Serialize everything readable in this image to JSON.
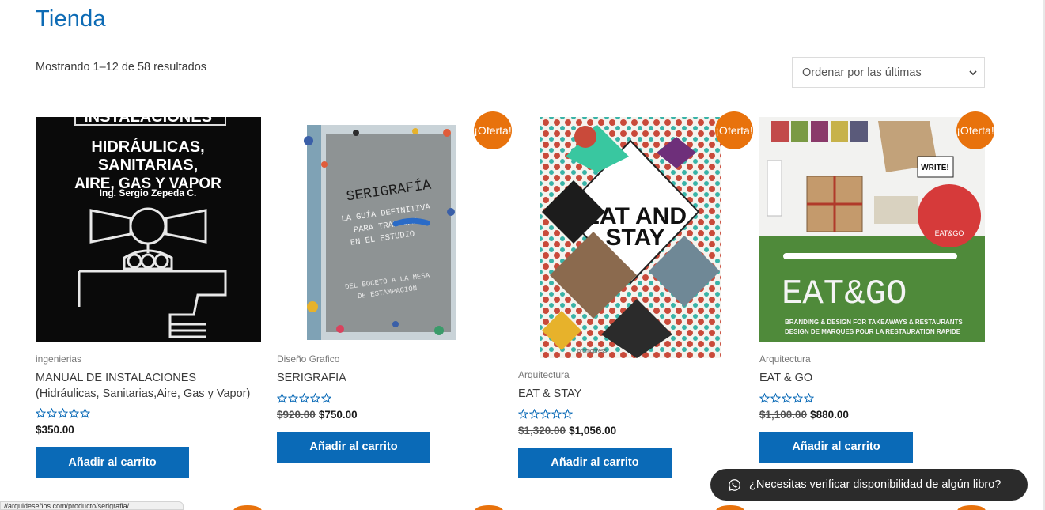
{
  "page": {
    "title": "Tienda"
  },
  "toolbar": {
    "result_count": "Mostrando 1–12 de 58 resultados",
    "orderby_label": "Ordenar por las últimas"
  },
  "products": [
    {
      "category": "ingenierias",
      "title": "MANUAL DE INSTALACIONES (Hidráulicas, Sanitarias,Aire, Gas y Vapor)",
      "price": "$350.00",
      "old_price": "",
      "on_sale": false,
      "button": "Añadir al carrito",
      "cover_text": [
        "INSTALACIONES",
        "HIDRÁULICAS,",
        "SANITARIAS,",
        "AIRE, GAS Y VAPOR",
        "Ing. Sergio Zepeda C."
      ]
    },
    {
      "category": "Diseño Grafico",
      "title": "SERIGRAFIA",
      "price": "$750.00",
      "old_price": "$920.00",
      "on_sale": true,
      "sale_label": "¡Oferta!",
      "button": "Añadir al carrito",
      "cover_text": [
        "SERIGRAFÍA",
        "LA GUÍA DEFINITIVA",
        "PARA TRABAJAR",
        "EN EL ESTUDIO",
        "DEL BOCETO A LA MESA",
        "DE ESTAMPACIÓN"
      ]
    },
    {
      "category": "Arquitectura",
      "title": "EAT & STAY",
      "price": "$1,056.00",
      "old_price": "$1,320.00",
      "on_sale": true,
      "sale_label": "¡Oferta!",
      "button": "Añadir al carrito",
      "cover_text": [
        "EAT AND",
        "STAY",
        "promopress"
      ]
    },
    {
      "category": "Arquitectura",
      "title": "EAT & GO",
      "price": "$880.00",
      "old_price": "$1,100.00",
      "on_sale": true,
      "sale_label": "¡Oferta!",
      "button": "Añadir al carrito",
      "cover_text": [
        "EAT&GO",
        "BRANDING & DESIGN FOR TAKEAWAYS & RESTAURANTS",
        "DESIGN DE MARQUES POUR LA RESTAURATION RAPIDE",
        "WRITE!",
        "EAT&GO"
      ]
    }
  ],
  "whatsapp": {
    "label": "¿Necesitas verificar disponibilidad de algún libro?"
  },
  "status_bar": {
    "url": "//arquideseños.com/producto/serigrafia/"
  },
  "colors": {
    "accent": "#0a6ab7",
    "sale": "#e8720c",
    "title": "#0d6bb5"
  },
  "icons": {
    "sort": "chevron-down-icon",
    "rating": "star-outline-icon",
    "chat": "whatsapp-icon"
  }
}
